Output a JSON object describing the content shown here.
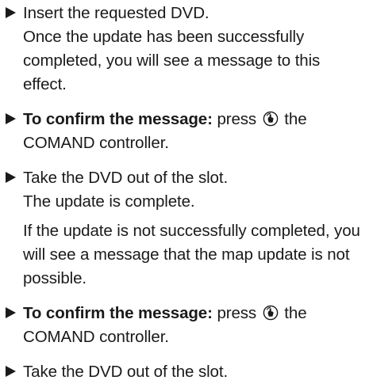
{
  "steps": [
    {
      "lines": [
        {
          "text": "Insert the requested DVD."
        },
        {
          "text": "Once the update has been successfully completed, you will see a message to this effect."
        }
      ]
    },
    {
      "bold": "To confirm the message:",
      "before_icon": "press",
      "icon": "controller-press-icon",
      "after_icon": "the COMAND controller."
    },
    {
      "lines": [
        {
          "text": "Take the DVD out of the slot."
        },
        {
          "text": "The update is complete."
        },
        {
          "text": "If the update is not successfully completed, you will see a message that the map update is not possible."
        }
      ]
    },
    {
      "bold": "To confirm the message:",
      "before_icon": "press",
      "icon": "controller-press-icon",
      "after_icon": "the COMAND controller."
    },
    {
      "lines": [
        {
          "text": "Take the DVD out of the slot."
        }
      ]
    }
  ]
}
